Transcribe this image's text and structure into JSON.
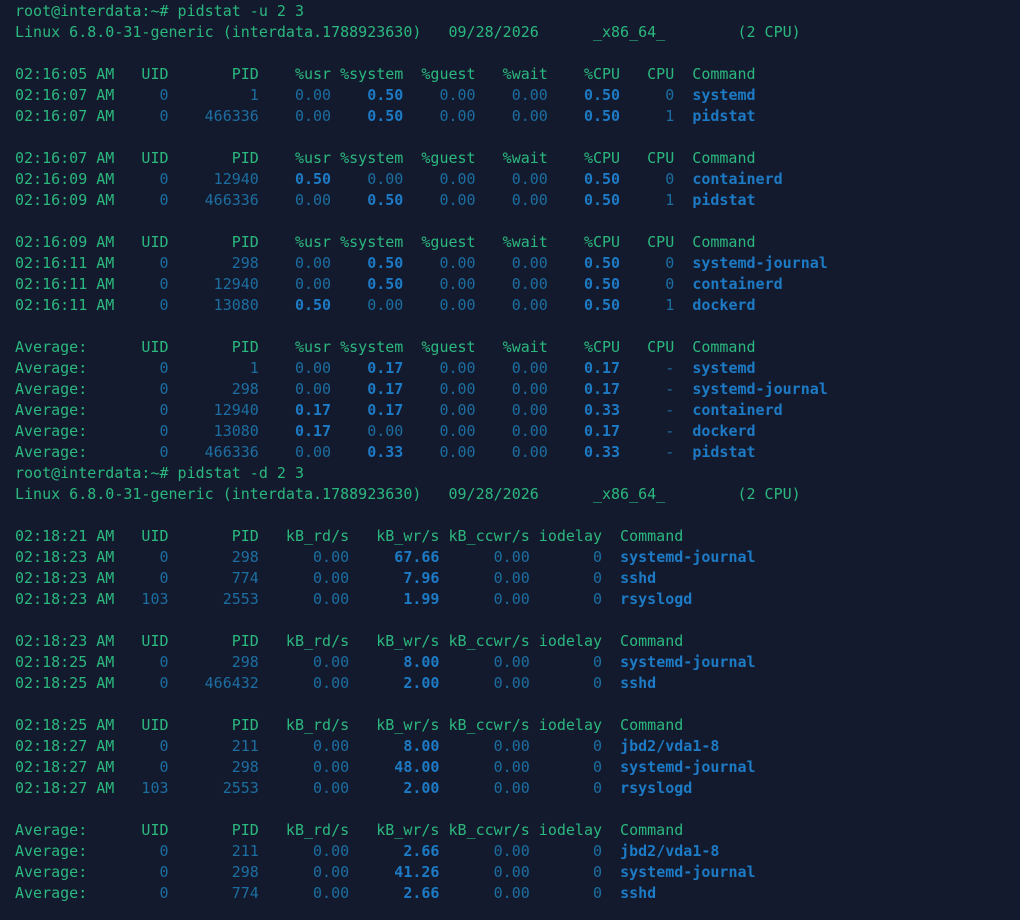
{
  "theme": {
    "background": "#141a2e",
    "text_green": "#2bb87e",
    "value_dim_blue": "#1c6ea0",
    "value_bold_blue": "#1d7ac4"
  },
  "terminal": {
    "lines": [
      [
        [
          "g",
          "root@interdata:~# pidstat -u 2 3"
        ]
      ],
      [
        [
          "g",
          "Linux 6.8.0-31-generic (interdata.1788923630)   09/28/2026      _x86_64_        (2 CPU)"
        ]
      ],
      [],
      [
        [
          "g",
          "02:16:05 AM   UID       PID    %usr %system  %guest   %wait    %CPU   CPU  Command"
        ]
      ],
      [
        [
          "g",
          "02:16:07 AM"
        ],
        [
          "d",
          "     0         1    0.00"
        ],
        [
          "b",
          "    0.50"
        ],
        [
          "d",
          "    0.00    0.00"
        ],
        [
          "b",
          "    0.50"
        ],
        [
          "d",
          "     0"
        ],
        [
          "b",
          "  systemd"
        ]
      ],
      [
        [
          "g",
          "02:16:07 AM"
        ],
        [
          "d",
          "     0    466336    0.00"
        ],
        [
          "b",
          "    0.50"
        ],
        [
          "d",
          "    0.00    0.00"
        ],
        [
          "b",
          "    0.50"
        ],
        [
          "d",
          "     1"
        ],
        [
          "b",
          "  pidstat"
        ]
      ],
      [],
      [
        [
          "g",
          "02:16:07 AM   UID       PID    %usr %system  %guest   %wait    %CPU   CPU  Command"
        ]
      ],
      [
        [
          "g",
          "02:16:09 AM"
        ],
        [
          "d",
          "     0     12940"
        ],
        [
          "b",
          "    0.50"
        ],
        [
          "d",
          "    0.00    0.00    0.00"
        ],
        [
          "b",
          "    0.50"
        ],
        [
          "d",
          "     0"
        ],
        [
          "b",
          "  containerd"
        ]
      ],
      [
        [
          "g",
          "02:16:09 AM"
        ],
        [
          "d",
          "     0    466336    0.00"
        ],
        [
          "b",
          "    0.50"
        ],
        [
          "d",
          "    0.00    0.00"
        ],
        [
          "b",
          "    0.50"
        ],
        [
          "d",
          "     1"
        ],
        [
          "b",
          "  pidstat"
        ]
      ],
      [],
      [
        [
          "g",
          "02:16:09 AM   UID       PID    %usr %system  %guest   %wait    %CPU   CPU  Command"
        ]
      ],
      [
        [
          "g",
          "02:16:11 AM"
        ],
        [
          "d",
          "     0       298    0.00"
        ],
        [
          "b",
          "    0.50"
        ],
        [
          "d",
          "    0.00    0.00"
        ],
        [
          "b",
          "    0.50"
        ],
        [
          "d",
          "     0"
        ],
        [
          "b",
          "  systemd-journal"
        ]
      ],
      [
        [
          "g",
          "02:16:11 AM"
        ],
        [
          "d",
          "     0     12940    0.00"
        ],
        [
          "b",
          "    0.50"
        ],
        [
          "d",
          "    0.00    0.00"
        ],
        [
          "b",
          "    0.50"
        ],
        [
          "d",
          "     0"
        ],
        [
          "b",
          "  containerd"
        ]
      ],
      [
        [
          "g",
          "02:16:11 AM"
        ],
        [
          "d",
          "     0     13080"
        ],
        [
          "b",
          "    0.50"
        ],
        [
          "d",
          "    0.00    0.00    0.00"
        ],
        [
          "b",
          "    0.50"
        ],
        [
          "d",
          "     1"
        ],
        [
          "b",
          "  dockerd"
        ]
      ],
      [],
      [
        [
          "g",
          "Average:      UID       PID    %usr %system  %guest   %wait    %CPU   CPU  Command"
        ]
      ],
      [
        [
          "g",
          "Average:   "
        ],
        [
          "d",
          "     0         1    0.00"
        ],
        [
          "b",
          "    0.17"
        ],
        [
          "d",
          "    0.00    0.00"
        ],
        [
          "b",
          "    0.17"
        ],
        [
          "d",
          "     -"
        ],
        [
          "b",
          "  systemd"
        ]
      ],
      [
        [
          "g",
          "Average:   "
        ],
        [
          "d",
          "     0       298    0.00"
        ],
        [
          "b",
          "    0.17"
        ],
        [
          "d",
          "    0.00    0.00"
        ],
        [
          "b",
          "    0.17"
        ],
        [
          "d",
          "     -"
        ],
        [
          "b",
          "  systemd-journal"
        ]
      ],
      [
        [
          "g",
          "Average:   "
        ],
        [
          "d",
          "     0     12940"
        ],
        [
          "b",
          "    0.17    0.17"
        ],
        [
          "d",
          "    0.00    0.00"
        ],
        [
          "b",
          "    0.33"
        ],
        [
          "d",
          "     -"
        ],
        [
          "b",
          "  containerd"
        ]
      ],
      [
        [
          "g",
          "Average:   "
        ],
        [
          "d",
          "     0     13080"
        ],
        [
          "b",
          "    0.17"
        ],
        [
          "d",
          "    0.00    0.00    0.00"
        ],
        [
          "b",
          "    0.17"
        ],
        [
          "d",
          "     -"
        ],
        [
          "b",
          "  dockerd"
        ]
      ],
      [
        [
          "g",
          "Average:   "
        ],
        [
          "d",
          "     0    466336    0.00"
        ],
        [
          "b",
          "    0.33"
        ],
        [
          "d",
          "    0.00    0.00"
        ],
        [
          "b",
          "    0.33"
        ],
        [
          "d",
          "     -"
        ],
        [
          "b",
          "  pidstat"
        ]
      ],
      [
        [
          "g",
          "root@interdata:~# pidstat -d 2 3"
        ]
      ],
      [
        [
          "g",
          "Linux 6.8.0-31-generic (interdata.1788923630)   09/28/2026      _x86_64_        (2 CPU)"
        ]
      ],
      [],
      [
        [
          "g",
          "02:18:21 AM   UID       PID   kB_rd/s   kB_wr/s kB_ccwr/s iodelay  Command"
        ]
      ],
      [
        [
          "g",
          "02:18:23 AM"
        ],
        [
          "d",
          "     0       298      0.00"
        ],
        [
          "b",
          "     67.66"
        ],
        [
          "d",
          "      0.00       0"
        ],
        [
          "b",
          "  systemd-journal"
        ]
      ],
      [
        [
          "g",
          "02:18:23 AM"
        ],
        [
          "d",
          "     0       774      0.00"
        ],
        [
          "b",
          "      7.96"
        ],
        [
          "d",
          "      0.00       0"
        ],
        [
          "b",
          "  sshd"
        ]
      ],
      [
        [
          "g",
          "02:18:23 AM"
        ],
        [
          "d",
          "   103      2553      0.00"
        ],
        [
          "b",
          "      1.99"
        ],
        [
          "d",
          "      0.00       0"
        ],
        [
          "b",
          "  rsyslogd"
        ]
      ],
      [],
      [
        [
          "g",
          "02:18:23 AM   UID       PID   kB_rd/s   kB_wr/s kB_ccwr/s iodelay  Command"
        ]
      ],
      [
        [
          "g",
          "02:18:25 AM"
        ],
        [
          "d",
          "     0       298      0.00"
        ],
        [
          "b",
          "      8.00"
        ],
        [
          "d",
          "      0.00       0"
        ],
        [
          "b",
          "  systemd-journal"
        ]
      ],
      [
        [
          "g",
          "02:18:25 AM"
        ],
        [
          "d",
          "     0    466432      0.00"
        ],
        [
          "b",
          "      2.00"
        ],
        [
          "d",
          "      0.00       0"
        ],
        [
          "b",
          "  sshd"
        ]
      ],
      [],
      [
        [
          "g",
          "02:18:25 AM   UID       PID   kB_rd/s   kB_wr/s kB_ccwr/s iodelay  Command"
        ]
      ],
      [
        [
          "g",
          "02:18:27 AM"
        ],
        [
          "d",
          "     0       211      0.00"
        ],
        [
          "b",
          "      8.00"
        ],
        [
          "d",
          "      0.00       0"
        ],
        [
          "b",
          "  jbd2/vda1-8"
        ]
      ],
      [
        [
          "g",
          "02:18:27 AM"
        ],
        [
          "d",
          "     0       298      0.00"
        ],
        [
          "b",
          "     48.00"
        ],
        [
          "d",
          "      0.00       0"
        ],
        [
          "b",
          "  systemd-journal"
        ]
      ],
      [
        [
          "g",
          "02:18:27 AM"
        ],
        [
          "d",
          "   103      2553      0.00"
        ],
        [
          "b",
          "      2.00"
        ],
        [
          "d",
          "      0.00       0"
        ],
        [
          "b",
          "  rsyslogd"
        ]
      ],
      [],
      [
        [
          "g",
          "Average:      UID       PID   kB_rd/s   kB_wr/s kB_ccwr/s iodelay  Command"
        ]
      ],
      [
        [
          "g",
          "Average:   "
        ],
        [
          "d",
          "     0       211      0.00"
        ],
        [
          "b",
          "      2.66"
        ],
        [
          "d",
          "      0.00       0"
        ],
        [
          "b",
          "  jbd2/vda1-8"
        ]
      ],
      [
        [
          "g",
          "Average:   "
        ],
        [
          "d",
          "     0       298      0.00"
        ],
        [
          "b",
          "     41.26"
        ],
        [
          "d",
          "      0.00       0"
        ],
        [
          "b",
          "  systemd-journal"
        ]
      ],
      [
        [
          "g",
          "Average:   "
        ],
        [
          "d",
          "     0       774      0.00"
        ],
        [
          "b",
          "      2.66"
        ],
        [
          "d",
          "      0.00       0"
        ],
        [
          "b",
          "  sshd"
        ]
      ]
    ]
  }
}
